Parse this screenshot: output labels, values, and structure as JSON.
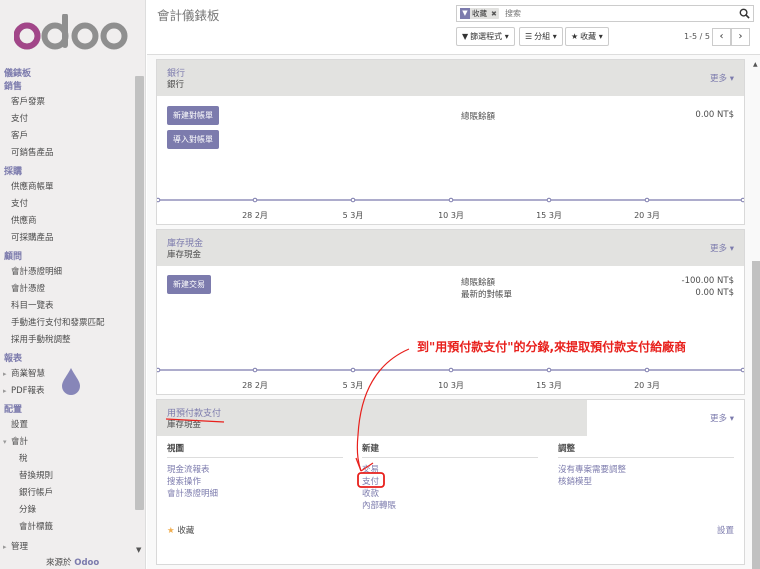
{
  "brand": {
    "logo_text": "odoo",
    "accent": "#7c7bad",
    "logo_color": "#8f8f8f"
  },
  "sidebar": {
    "sections": [
      {
        "label": "儀錶板"
      },
      {
        "label": "銷售",
        "items": [
          "客戶發票",
          "支付",
          "客戶",
          "可銷售產品"
        ]
      },
      {
        "label": "採購",
        "items": [
          "供應商帳單",
          "支付",
          "供應商",
          "可採購產品"
        ]
      },
      {
        "label": "顧問",
        "items": [
          "會計憑證明細",
          "會計憑證",
          "科目一覽表",
          "手動進行支付和發票匹配",
          "採用手動稅調整"
        ]
      },
      {
        "label": "報表",
        "items": [
          "商業智慧",
          "PDF報表"
        ]
      },
      {
        "label": "配置",
        "items": [
          "設置",
          "會計"
        ],
        "subitems": [
          "稅",
          "替換規則",
          "銀行帳戶",
          "分錄",
          "會計標籤"
        ],
        "last": "管理"
      }
    ],
    "footer_prefix": "來源於",
    "footer_brand": "Odoo"
  },
  "control_panel": {
    "title": "會計儀錶板",
    "facet": "收藏",
    "search_placeholder": "搜索",
    "filters_label": "篩選程式",
    "groupby_label": "分組",
    "favorites_label": "收藏",
    "pager": "1-5 / 5"
  },
  "journals": [
    {
      "name": "銀行",
      "type": "銀行",
      "more": "更多",
      "buttons": [
        "新建對帳單",
        "導入對帳單"
      ],
      "stats": [
        {
          "label": "總賬餘額",
          "value": "0.00 NT$"
        }
      ],
      "graph_labels": [
        "28 2月",
        "5 3月",
        "10 3月",
        "15 3月",
        "20 3月"
      ]
    },
    {
      "name": "庫存現金",
      "type": "庫存現金",
      "more": "更多",
      "buttons": [
        "新建交易"
      ],
      "stats": [
        {
          "label": "總賬餘額",
          "value": "-100.00 NT$"
        },
        {
          "label": "最新的對帳單",
          "value": "0.00 NT$"
        }
      ],
      "graph_labels": [
        "28 2月",
        "5 3月",
        "10 3月",
        "15 3月",
        "20 3月"
      ]
    },
    {
      "name": "用預付款支付",
      "type": "庫存現金",
      "more": "更多",
      "columns": [
        {
          "title": "視圖",
          "links": [
            "現金流報表",
            "搜索操作",
            "會計憑證明細"
          ]
        },
        {
          "title": "新建",
          "links": [
            "交易",
            "支付",
            "收款",
            "內部轉賬"
          ]
        },
        {
          "title": "調整",
          "links": [
            "沒有專案需要調整",
            "核銷模型"
          ]
        }
      ],
      "favorite": "收藏",
      "settings": "設置"
    }
  ],
  "annotation": {
    "text": "到\"用預付款支付\"的分錄,來提取預付款支付給廠商",
    "color": "#e8201c"
  }
}
